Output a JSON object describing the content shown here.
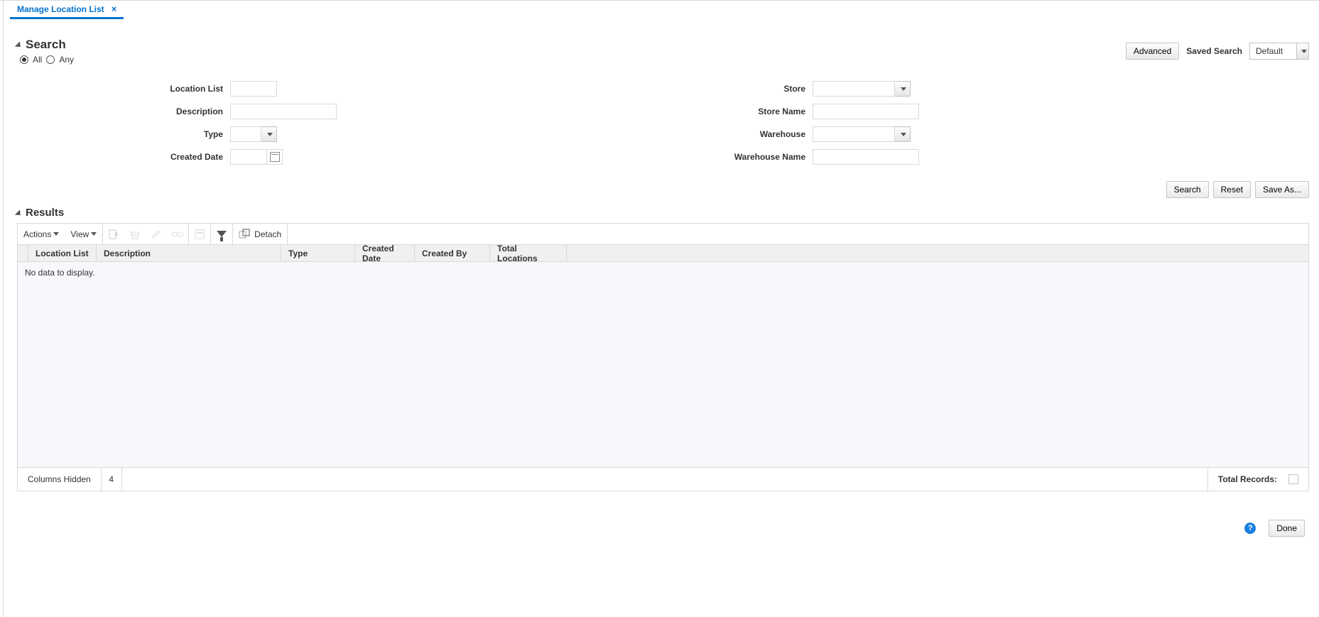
{
  "tab": {
    "title": "Manage Location List"
  },
  "search": {
    "heading": "Search",
    "match_all": "All",
    "match_any": "Any",
    "advanced_btn": "Advanced",
    "saved_label": "Saved Search",
    "saved_value": "Default",
    "fields": {
      "location_list": "Location List",
      "description": "Description",
      "type": "Type",
      "created_date": "Created Date",
      "store": "Store",
      "store_name": "Store Name",
      "warehouse": "Warehouse",
      "warehouse_name": "Warehouse Name"
    },
    "buttons": {
      "search": "Search",
      "reset": "Reset",
      "saveas": "Save As..."
    }
  },
  "results": {
    "heading": "Results",
    "menu_actions": "Actions",
    "menu_view": "View",
    "detach": "Detach",
    "columns": [
      "Location List",
      "Description",
      "Type",
      "Created Date",
      "Created By",
      "Total Locations"
    ],
    "empty": "No data to display.",
    "columns_hidden_label": "Columns Hidden",
    "columns_hidden_count": "4",
    "total_records_label": "Total Records:"
  },
  "footer": {
    "done": "Done"
  }
}
